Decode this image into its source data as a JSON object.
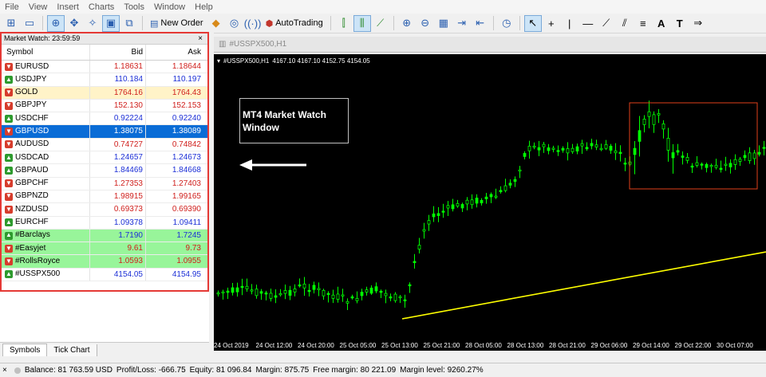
{
  "menu": [
    "File",
    "View",
    "Insert",
    "Charts",
    "Tools",
    "Window",
    "Help"
  ],
  "toolbar": {
    "new_order_label": "New Order",
    "autotrading_label": "AutoTrading"
  },
  "market_watch": {
    "title": "Market Watch: 23:59:59",
    "close_glyph": "×",
    "columns": {
      "symbol": "Symbol",
      "bid": "Bid",
      "ask": "Ask"
    },
    "rows": [
      {
        "symbol": "EURUSD",
        "bid": "1.18631",
        "ask": "1.18644",
        "dir": "down",
        "bid_color": "#d0201d",
        "ask_color": "#d0201d"
      },
      {
        "symbol": "USDJPY",
        "bid": "110.184",
        "ask": "110.197",
        "dir": "up",
        "bid_color": "#1c2fd6",
        "ask_color": "#1c2fd6"
      },
      {
        "symbol": "GOLD",
        "bid": "1764.16",
        "ask": "1764.43",
        "dir": "down",
        "bid_color": "#d0201d",
        "ask_color": "#d0201d"
      },
      {
        "symbol": "GBPJPY",
        "bid": "152.130",
        "ask": "152.153",
        "dir": "down",
        "bid_color": "#d0201d",
        "ask_color": "#d0201d"
      },
      {
        "symbol": "USDCHF",
        "bid": "0.92224",
        "ask": "0.92240",
        "dir": "up",
        "bid_color": "#1c2fd6",
        "ask_color": "#1c2fd6"
      },
      {
        "symbol": "GBPUSD",
        "bid": "1.38075",
        "ask": "1.38089",
        "dir": "down",
        "bid_color": "#ffffff",
        "ask_color": "#ffffff"
      },
      {
        "symbol": "AUDUSD",
        "bid": "0.74727",
        "ask": "0.74842",
        "dir": "down",
        "bid_color": "#d0201d",
        "ask_color": "#d0201d"
      },
      {
        "symbol": "USDCAD",
        "bid": "1.24657",
        "ask": "1.24673",
        "dir": "up",
        "bid_color": "#1c2fd6",
        "ask_color": "#1c2fd6"
      },
      {
        "symbol": "GBPAUD",
        "bid": "1.84469",
        "ask": "1.84668",
        "dir": "up",
        "bid_color": "#1c2fd6",
        "ask_color": "#1c2fd6"
      },
      {
        "symbol": "GBPCHF",
        "bid": "1.27353",
        "ask": "1.27403",
        "dir": "down",
        "bid_color": "#d0201d",
        "ask_color": "#d0201d"
      },
      {
        "symbol": "GBPNZD",
        "bid": "1.98915",
        "ask": "1.99165",
        "dir": "down",
        "bid_color": "#d0201d",
        "ask_color": "#d0201d"
      },
      {
        "symbol": "NZDUSD",
        "bid": "0.69373",
        "ask": "0.69390",
        "dir": "down",
        "bid_color": "#d0201d",
        "ask_color": "#d0201d"
      },
      {
        "symbol": "EURCHF",
        "bid": "1.09378",
        "ask": "1.09411",
        "dir": "up",
        "bid_color": "#1c2fd6",
        "ask_color": "#1c2fd6"
      },
      {
        "symbol": "#Barclays",
        "bid": "1.7190",
        "ask": "1.7245",
        "dir": "up",
        "bid_color": "#1c2fd6",
        "ask_color": "#1c2fd6"
      },
      {
        "symbol": "#Easyjet",
        "bid": "9.61",
        "ask": "9.73",
        "dir": "down",
        "bid_color": "#d0201d",
        "ask_color": "#d0201d"
      },
      {
        "symbol": "#RollsRoyce",
        "bid": "1.0593",
        "ask": "1.0955",
        "dir": "down",
        "bid_color": "#d0201d",
        "ask_color": "#d0201d"
      },
      {
        "symbol": "#USSPX500",
        "bid": "4154.05",
        "ask": "4154.95",
        "dir": "up",
        "bid_color": "#1c2fd6",
        "ask_color": "#1c2fd6"
      }
    ],
    "tabs": [
      "Symbols",
      "Tick Chart"
    ]
  },
  "chart": {
    "tab_label": "#USSPX500,H1",
    "header_symbol": "#USSPX500,H1",
    "header_values": "4167.10 4167.10 4152.75 4154.05",
    "callout_text": "MT4 Market Watch Window",
    "x_labels": [
      "24 Oct 2019",
      "24 Oct 12:00",
      "24 Oct 20:00",
      "25 Oct 05:00",
      "25 Oct 13:00",
      "25 Oct 21:00",
      "28 Oct 05:00",
      "28 Oct 13:00",
      "28 Oct 21:00",
      "29 Oct 06:00",
      "29 Oct 14:00",
      "29 Oct 22:00",
      "30 Oct 07:00"
    ],
    "candle_color": "#00ff00",
    "trendline_color": "#ffff00",
    "highlight_color": "#e0401a"
  },
  "status": {
    "balance": "Balance: 81 763.59 USD",
    "profit": "Profit/Loss: -666.75",
    "equity": "Equity: 81 096.84",
    "margin": "Margin: 875.75",
    "free_margin": "Free margin: 80 221.09",
    "margin_level": "Margin level: 9260.27%"
  }
}
